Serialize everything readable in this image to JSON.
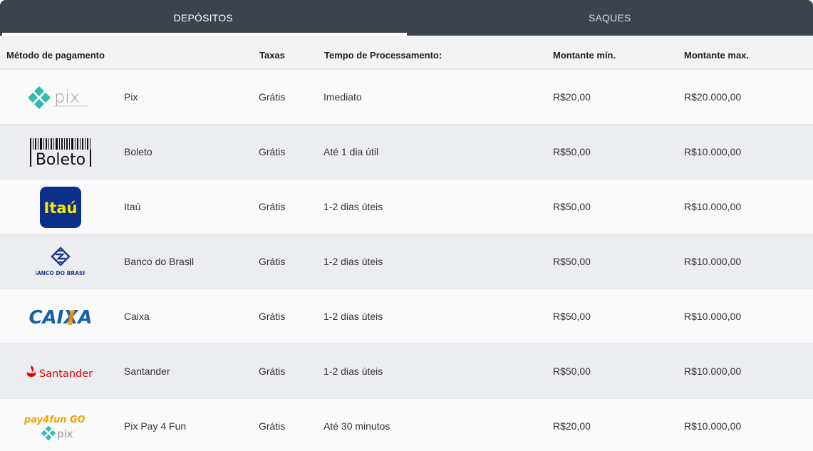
{
  "tabs": [
    {
      "label": "DEPÓSITOS",
      "active": true
    },
    {
      "label": "SAQUES",
      "active": false
    }
  ],
  "columns": {
    "method": "Método de pagamento",
    "fees": "Taxas",
    "time": "Tempo de Processamento:",
    "min": "Montante mín.",
    "max": "Montante max."
  },
  "rows": [
    {
      "logo": "pix-logo",
      "logo_text": "pix",
      "name": "Pix",
      "fee": "Grátis",
      "time": "Imediato",
      "min": "R$20,00",
      "max": "R$20.000,00"
    },
    {
      "logo": "boleto-logo",
      "logo_text": "Boleto",
      "name": "Boleto",
      "fee": "Grátis",
      "time": "Até 1 dia útil",
      "min": "R$50,00",
      "max": "R$10.000,00"
    },
    {
      "logo": "itau-logo",
      "logo_text": "Itaú",
      "name": "Itaú",
      "fee": "Grátis",
      "time": "1-2 dias úteis",
      "min": "R$50,00",
      "max": "R$10.000,00"
    },
    {
      "logo": "banco-do-brasil-logo",
      "logo_text": "BANCO DO BRASIL",
      "name": "Banco do Brasil",
      "fee": "Grátis",
      "time": "1-2 dias úteis",
      "min": "R$50,00",
      "max": "R$10.000,00"
    },
    {
      "logo": "caixa-logo",
      "logo_text": "CAIXA",
      "name": "Caixa",
      "fee": "Grátis",
      "time": "1-2 dias úteis",
      "min": "R$50,00",
      "max": "R$10.000,00"
    },
    {
      "logo": "santander-logo",
      "logo_text": "Santander",
      "name": "Santander",
      "fee": "Grátis",
      "time": "1-2 dias úteis",
      "min": "R$50,00",
      "max": "R$10.000,00"
    },
    {
      "logo": "pay4fun-go-logo",
      "logo_text": "pay4fun GO",
      "name": "Pix Pay 4 Fun",
      "fee": "Grátis",
      "time": "Até 30 minutos",
      "min": "R$20,00",
      "max": "R$10.000,00"
    }
  ],
  "colors": {
    "header_bg": "#3d434c",
    "pix_teal": "#32bcad",
    "itau_blue": "#0c2f8a",
    "itau_yellow": "#ffe600",
    "bb_blue": "#1f3a8a",
    "caixa_blue": "#1660a8",
    "caixa_orange": "#f39200",
    "santander_red": "#ec0000",
    "pay4fun_orange": "#f5a300",
    "pay4fun_purple": "#5b2d86"
  }
}
